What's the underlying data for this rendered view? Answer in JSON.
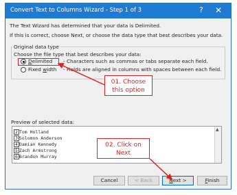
{
  "window": {
    "title": "Convert Text to Columns Wizard - Step 1 of 3",
    "help_label": "?",
    "close_label": "✕"
  },
  "intro": {
    "line1": "The Text Wizard has determined that your data is Delimited.",
    "line2": "If this is correct, choose Next, or choose the data type that best describes your data."
  },
  "original_data_type": {
    "group_label": "Original data type",
    "prompt": "Choose the file type that best describes your data:",
    "options": [
      {
        "label_pre": "",
        "label_u": "D",
        "label_post": "elimited",
        "description": "- Characters such as commas or tabs separate each field.",
        "selected": true
      },
      {
        "label_pre": "Fixed ",
        "label_u": "w",
        "label_post": "idth",
        "description": "- Fields are aligned in columns with spaces between each field.",
        "selected": false
      }
    ]
  },
  "preview": {
    "label": "Preview of selected data:",
    "rows": [
      {
        "n": "2",
        "text": "Tom Holland"
      },
      {
        "n": "3",
        "text": "Solomon Anderson"
      },
      {
        "n": "4",
        "text": "Damian Kennedy"
      },
      {
        "n": "5",
        "text": "Zach Armstrong"
      },
      {
        "n": "6",
        "text": "Brandon Murray"
      }
    ]
  },
  "buttons": {
    "cancel": "Cancel",
    "back": "< Back",
    "next_pre": "",
    "next_u": "N",
    "next_post": "ext >",
    "finish_pre": "",
    "finish_u": "F",
    "finish_post": "inish"
  },
  "annotations": {
    "callout1": {
      "line1": "01. Choose",
      "line2": "this option"
    },
    "callout2": {
      "line1": "02. Click on",
      "line2": "Next"
    },
    "color": "#e02020"
  },
  "colors": {
    "titlebar": "#1f7bd1",
    "dialog_bg": "#f0f0f0",
    "accent_button": "#0067c0"
  }
}
